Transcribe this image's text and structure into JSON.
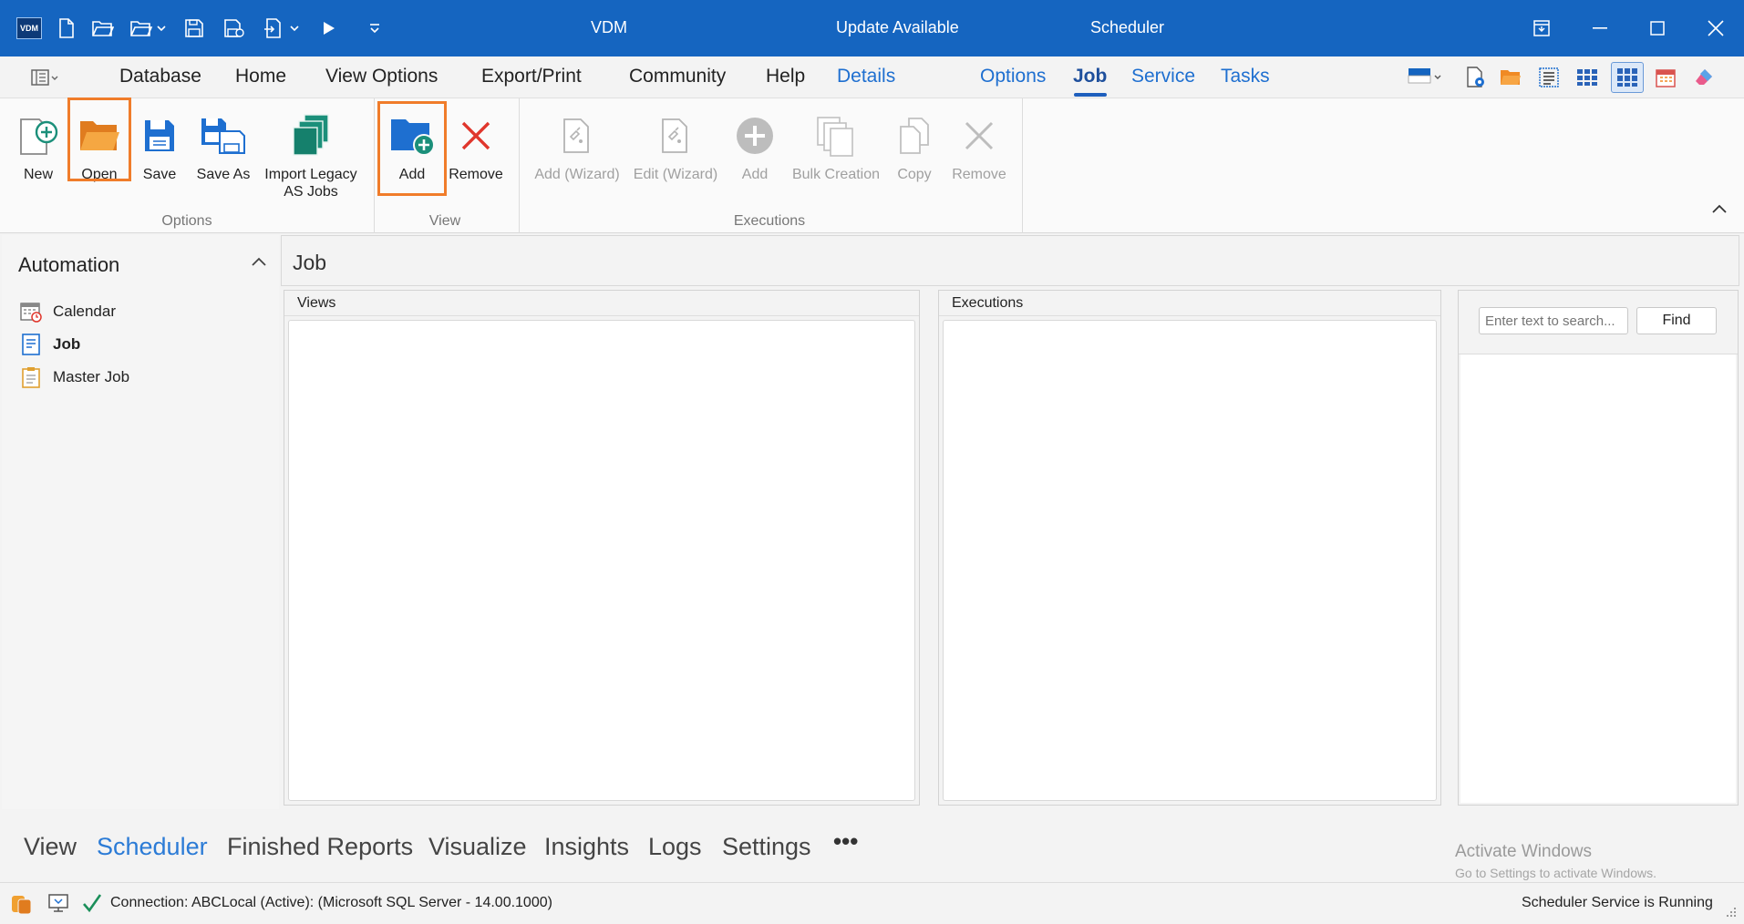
{
  "titlebar": {
    "logo_text": "VDM",
    "app_title": "VDM",
    "update_text": "Update Available",
    "window_title": "Scheduler"
  },
  "menubar": {
    "items": [
      "Database",
      "Home",
      "View Options",
      "Export/Print",
      "Community",
      "Help"
    ],
    "context_items": [
      "Details",
      "Options",
      "Job",
      "Service",
      "Tasks"
    ],
    "active_tab": "Job"
  },
  "ribbon": {
    "options_group": {
      "label": "Options",
      "buttons": [
        "New",
        "Open",
        "Save",
        "Save As",
        "Import Legacy\nAS Jobs"
      ]
    },
    "view_group": {
      "label": "View",
      "buttons": [
        "Add",
        "Remove"
      ]
    },
    "executions_group": {
      "label": "Executions",
      "buttons": [
        "Add (Wizard)",
        "Edit (Wizard)",
        "Add",
        "Bulk Creation",
        "Copy",
        "Remove"
      ]
    }
  },
  "sidebar": {
    "title": "Automation",
    "items": [
      {
        "label": "Calendar",
        "icon": "calendar-icon"
      },
      {
        "label": "Job",
        "icon": "job-icon"
      },
      {
        "label": "Master Job",
        "icon": "clipboard-icon"
      }
    ]
  },
  "main": {
    "title": "Job",
    "views_label": "Views",
    "executions_label": "Executions",
    "search": {
      "placeholder": "Enter text to search...",
      "find_label": "Find"
    }
  },
  "bottomnav": {
    "items": [
      "View",
      "Scheduler",
      "Finished Reports",
      "Visualize",
      "Insights",
      "Logs",
      "Settings"
    ],
    "active": "Scheduler",
    "more": "•••"
  },
  "watermark": {
    "title": "Activate Windows",
    "subtitle": "Go to Settings to activate Windows."
  },
  "statusbar": {
    "connection": "Connection: ABCLocal (Active): (Microsoft SQL Server - 14.00.1000)",
    "service": "Scheduler Service is Running"
  },
  "colors": {
    "titlebar": "#1565c0",
    "accent": "#1e6fd0",
    "highlight": "#f07c2a"
  }
}
